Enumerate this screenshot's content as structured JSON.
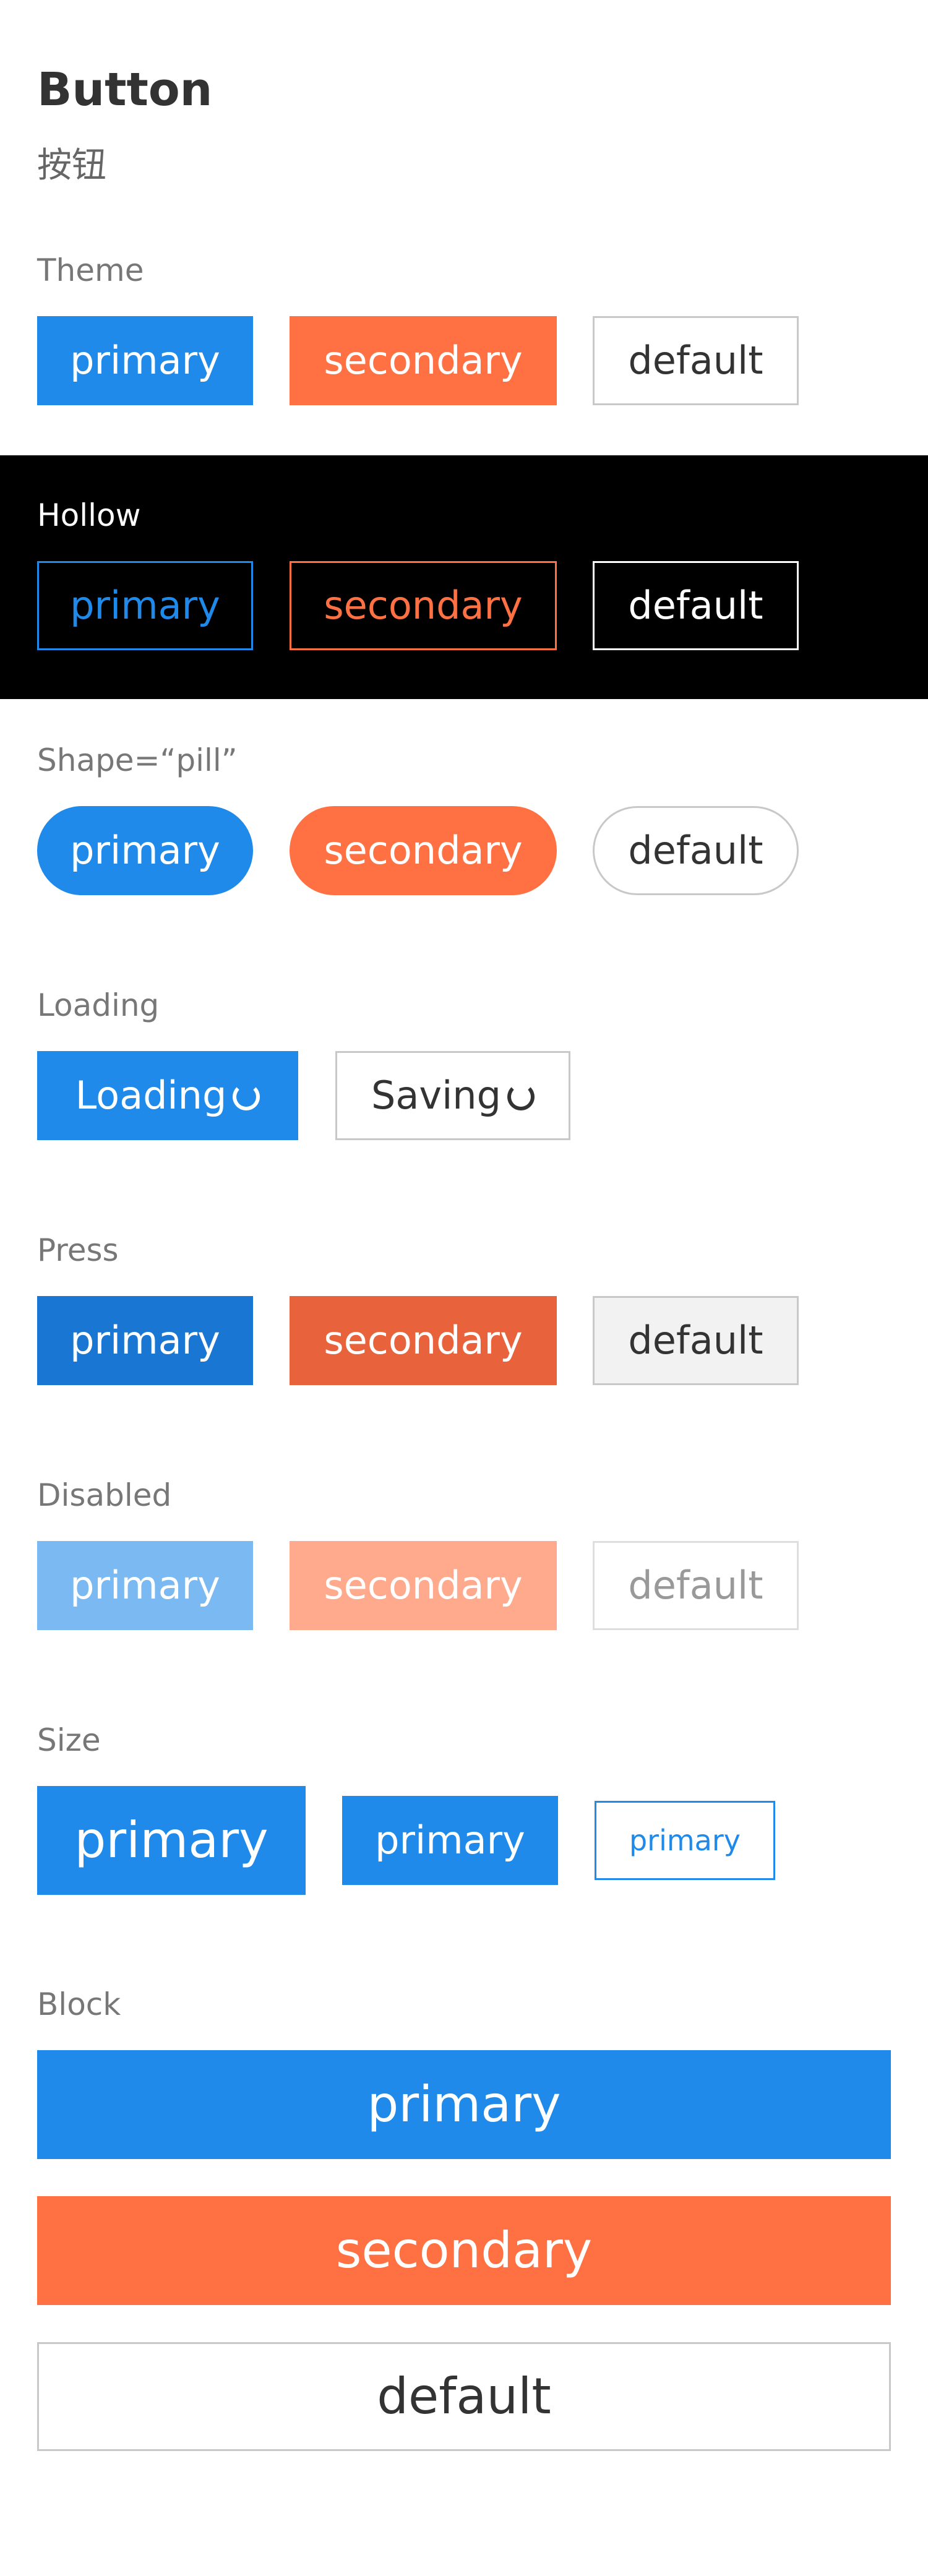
{
  "page": {
    "title": "Button",
    "subtitle": "按钮"
  },
  "sections": {
    "theme": {
      "label": "Theme",
      "buttons": [
        "primary",
        "secondary",
        "default"
      ]
    },
    "hollow": {
      "label": "Hollow",
      "buttons": [
        "primary",
        "secondary",
        "default"
      ]
    },
    "shape": {
      "label": "Shape=“pill”",
      "buttons": [
        "primary",
        "secondary",
        "default"
      ]
    },
    "loading": {
      "label": "Loading",
      "buttons": [
        "Loading",
        "Saving"
      ]
    },
    "press": {
      "label": "Press",
      "buttons": [
        "primary",
        "secondary",
        "default"
      ]
    },
    "disabled": {
      "label": "Disabled",
      "buttons": [
        "primary",
        "secondary",
        "default"
      ]
    },
    "size": {
      "label": "Size",
      "buttons": [
        "primary",
        "primary",
        "primary"
      ]
    },
    "block": {
      "label": "Block",
      "buttons": [
        "primary",
        "secondary",
        "default"
      ]
    }
  },
  "colors": {
    "primary": "#1f8ae9",
    "secondary": "#ff7142",
    "default_border": "#c8c8c8",
    "hollow_background": "#000000"
  },
  "icons": {
    "loading": "spinner-icon"
  }
}
